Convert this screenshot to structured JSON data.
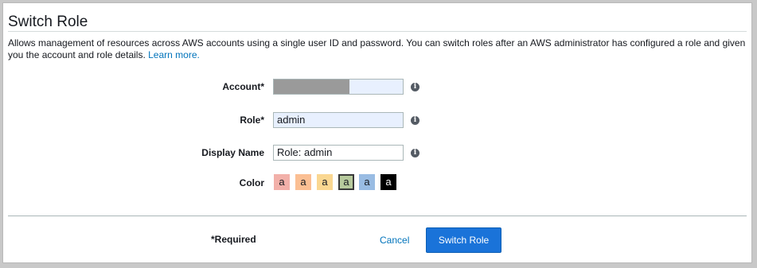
{
  "header": {
    "title": "Switch Role",
    "description": "Allows management of resources across AWS accounts using a single user ID and password. You can switch roles after an AWS administrator has configured a role and given you the account and role details.",
    "learn_more": "Learn more."
  },
  "form": {
    "account": {
      "label": "Account*",
      "value": ""
    },
    "role": {
      "label": "Role*",
      "value": "admin"
    },
    "display_name": {
      "label": "Display Name",
      "value": "Role: admin"
    },
    "color": {
      "label": "Color",
      "swatches": [
        {
          "letter": "a",
          "color": "#f2b0a9"
        },
        {
          "letter": "a",
          "color": "#fbbf93"
        },
        {
          "letter": "a",
          "color": "#fad791"
        },
        {
          "letter": "a",
          "color": "#b7ca9d",
          "selected": true
        },
        {
          "letter": "a",
          "color": "#99bce3"
        },
        {
          "letter": "a",
          "color": "#000000",
          "text_color": "#ffffff"
        }
      ]
    },
    "info_icon": "i"
  },
  "footer": {
    "required_note": "*Required",
    "cancel_label": "Cancel",
    "submit_label": "Switch Role"
  },
  "colors": {
    "link": "#0073bb",
    "primary_button": "#1a73d9",
    "autofill_field": "#e8f0fe"
  }
}
